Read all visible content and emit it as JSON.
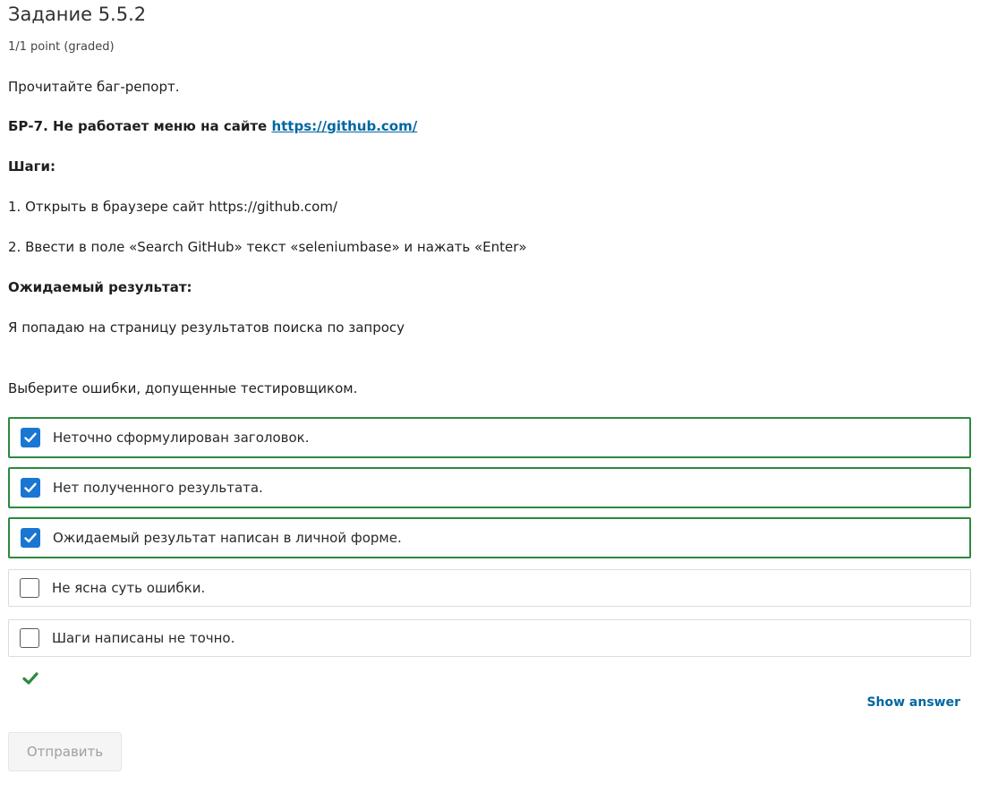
{
  "problem": {
    "title": "Задание 5.5.2",
    "points": "1/1 point (graded)"
  },
  "report": {
    "intro": "Прочитайте баг-репорт.",
    "heading_text": "БР-7. Не работает меню на сайте ",
    "heading_link": "https://github.com/",
    "steps_label": "Шаги:",
    "step1": "1. Открыть в браузере сайт https://github.com/",
    "step2": "2. Ввести в поле «Search GitHub» текст «seleniumbase» и нажать «Enter»",
    "expected_label": "Ожидаемый результат:",
    "expected_text": "Я попадаю на страницу результатов поиска по запросу"
  },
  "question": "Выберите ошибки, допущенные тестировщиком.",
  "choices": [
    {
      "label": "Неточно сформулирован заголовок.",
      "checked": true,
      "correct": true
    },
    {
      "label": "Нет полученного результата.",
      "checked": true,
      "correct": true
    },
    {
      "label": "Ожидаемый результат написан в личной форме.",
      "checked": true,
      "correct": true
    },
    {
      "label": "Не ясна суть ошибки.",
      "checked": false,
      "correct": false
    },
    {
      "label": "Шаги написаны не точно.",
      "checked": false,
      "correct": false
    }
  ],
  "actions": {
    "show_answer": "Show answer",
    "submit": "Отправить"
  },
  "colors": {
    "correct_border": "#2b8a3e",
    "checkbox_checked": "#1976d2",
    "link": "#0066a2",
    "success_check": "#2b8a3e"
  },
  "icons": {
    "checkbox": "check-icon",
    "result": "correct-checkmark-icon"
  }
}
